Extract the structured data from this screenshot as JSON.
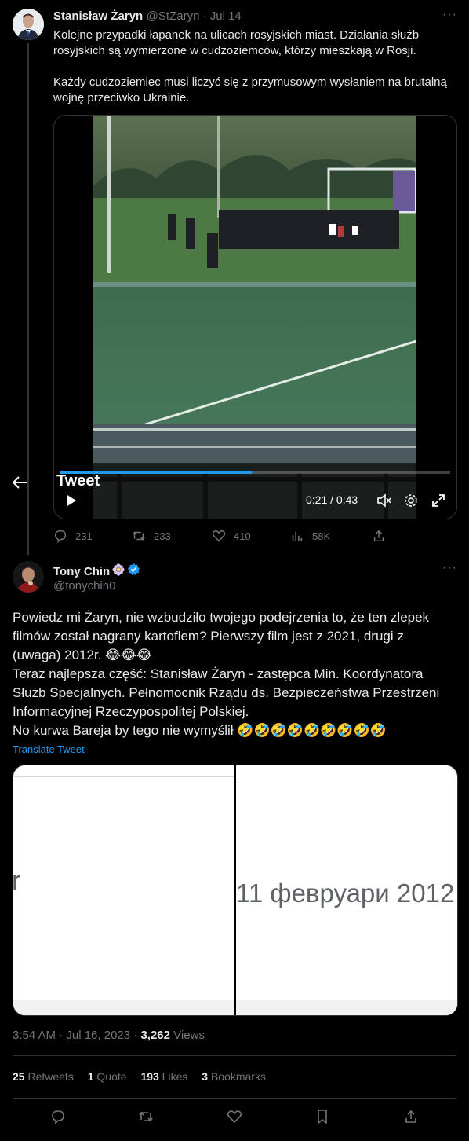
{
  "tweet1": {
    "author_name": "Stanisław Żaryn",
    "handle_time": "@StZaryn · Jul 14",
    "text_line1": "Kolejne przypadki łapanek na ulicach rosyjskich miast. Działania służb",
    "text_line2": "rosyjskich są wymierzone w cudzoziemców, którzy mieszkają w Rosji.",
    "text_line3": "Każdy cudzoziemiec musi liczyć się z przymusowym wysłaniem na brutalną",
    "text_line4": "wojnę przeciwko Ukrainie.",
    "video_time": "0:21 / 0:43",
    "overlay_title": "Tweet",
    "replies": "231",
    "retweets": "233",
    "likes": "410",
    "views": "58K"
  },
  "tweet2": {
    "author_name": "Tony Chin",
    "handle": "@tonychin0",
    "lines": [
      "Powiedz mi Żaryn, nie wzbudziło twojego podejrzenia to, że ten zlepek",
      "filmów został nagrany kartoflem? Pierwszy film jest z 2021, drugi z",
      "(uwaga) 2012r. 😂😂😂",
      "Teraz najlepsza część: Stanisław Żaryn - zastępca Min. Koordynatora",
      "Służb Specjalnych. Pełnomocnik Rządu ds. Bezpieczeństwa Przestrzeni",
      "Informacyjnej Rzeczypospolitej Polskiej.",
      "No kurwa Bareja by tego nie wymyślił 🤣🤣🤣🤣🤣🤣🤣🤣🤣"
    ],
    "translate": "Translate Tweet",
    "image_left_text": "r",
    "image_right_text": "11 февруари 2012",
    "timestamp": "3:54 AM · Jul 16, 2023 · ",
    "views_count": "3,262",
    "views_label": " Views",
    "retweets_count": "25",
    "retweets_label": " Retweets",
    "quote_count": "1",
    "quote_label": " Quote",
    "likes_count": "193",
    "likes_label": " Likes",
    "bookmarks_count": "3",
    "bookmarks_label": " Bookmarks"
  },
  "colors": {
    "accent": "#1d9bf0",
    "muted": "#71767b",
    "border": "#2f3336"
  }
}
